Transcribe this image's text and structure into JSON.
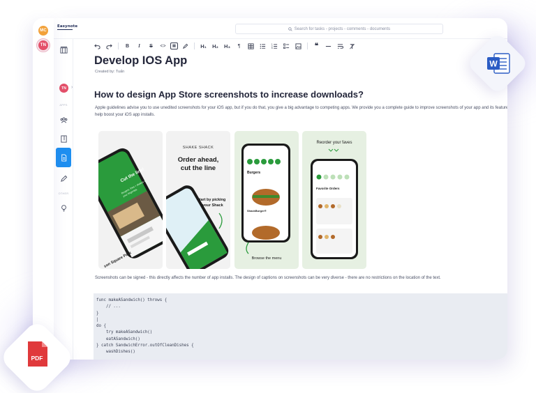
{
  "rail": {
    "user_initials": "MC",
    "workspace_initials": "TN"
  },
  "topbar": {
    "logo_text": "Easynote",
    "search_placeholder": "Search for tasks - projects - comments - documents"
  },
  "sidebar": {
    "workspace_initials": "TN",
    "section_apps": "APPS",
    "section_other": "OTHER",
    "items": [
      "home",
      "team",
      "notebook",
      "documents",
      "draw",
      "ideas"
    ]
  },
  "toolbar": {
    "bold": "B",
    "italic": "I",
    "strike": "S",
    "code_inline": "<>",
    "code_block": "⌨",
    "h1": "H₁",
    "h2": "H₂",
    "h3": "H₃",
    "paragraph": "¶",
    "quote": "❝",
    "clear": "T̸"
  },
  "document": {
    "title": "Develop IOS App",
    "created_by": "Created by: Tuấn",
    "heading": "How to design App Store screenshots to increase downloads?",
    "paragraph": "Apple guidelines advise you to use unedited screenshots for your iOS app, but if you do that, you give a big advantage to competing apps. We provide you a complete guide to improve screenshots of your app and its features to help boost your iOS app installs.",
    "caption": "Screenshots can be signed - this directly affects the number of app installs. The design of captions on screenshots can be very diverse - there are no restrictions on the location of the text.",
    "code_lines": [
      "func makeASandwich() throws {",
      "    // ...",
      "}",
      "|",
      "do {",
      "    try makeASandwich()",
      "    eatASandwich()",
      "} catch SandwichError.outOfCleanDishes {",
      "    washDishes()"
    ]
  },
  "screenshots": {
    "shot1": {
      "headline": "Cut the line!",
      "sub": "Burgers, fries + shakes at your fingertips.",
      "bottom": "son Square Park"
    },
    "shot2": {
      "brand": "SHAKE SHACK",
      "headline1": "Order ahead,",
      "headline2": "cut the line",
      "cta1": "Start by picking",
      "cta2": "your Shack"
    },
    "shot3": {
      "heading": "Burgers",
      "item": "ShackBurger®",
      "footer": "Browse the menu"
    },
    "shot4": {
      "headline": "Reorder your faves",
      "heading": "Favorite Orders"
    }
  },
  "badges": {
    "word": "W",
    "pdf": "PDF"
  },
  "colors": {
    "accent": "#1e8ff0",
    "avatar_orange": "#f2a13a",
    "avatar_pink": "#e4506a",
    "shack_green": "#2a9b3c",
    "screenshot_bg": "#e6f0e2",
    "code_bg": "#e9ecf2",
    "word_blue": "#2b5cc4",
    "pdf_red": "#e0393b"
  }
}
